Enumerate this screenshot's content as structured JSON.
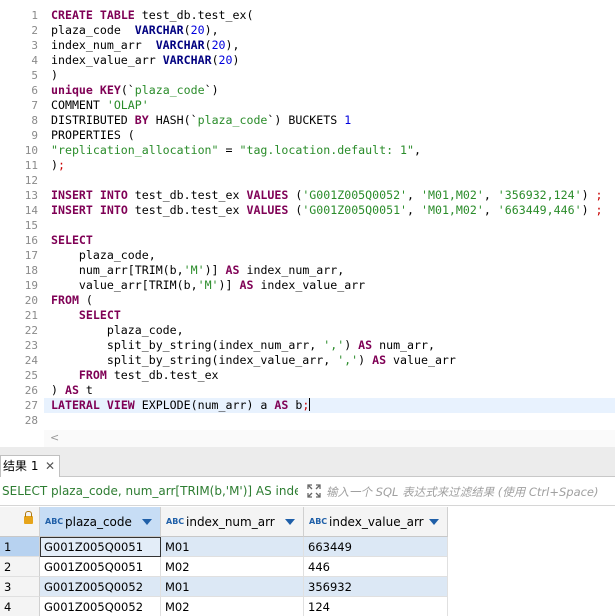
{
  "editor": {
    "lines": [
      {
        "n": "1",
        "tokens": [
          {
            "t": "kw",
            "v": "CREATE"
          },
          {
            "t": "",
            "v": " "
          },
          {
            "t": "kw",
            "v": "TABLE"
          },
          {
            "t": "",
            "v": " test_db.test_ex("
          }
        ]
      },
      {
        "n": "2",
        "tokens": [
          {
            "t": "",
            "v": "plaza_code  "
          },
          {
            "t": "kb",
            "v": "VARCHAR"
          },
          {
            "t": "",
            "v": "("
          },
          {
            "t": "num",
            "v": "20"
          },
          {
            "t": "",
            "v": "),"
          }
        ]
      },
      {
        "n": "3",
        "tokens": [
          {
            "t": "",
            "v": "index_num_arr  "
          },
          {
            "t": "kb",
            "v": "VARCHAR"
          },
          {
            "t": "",
            "v": "("
          },
          {
            "t": "num",
            "v": "20"
          },
          {
            "t": "",
            "v": "),"
          }
        ]
      },
      {
        "n": "4",
        "tokens": [
          {
            "t": "",
            "v": "index_value_arr "
          },
          {
            "t": "kb",
            "v": "VARCHAR"
          },
          {
            "t": "",
            "v": "("
          },
          {
            "t": "num",
            "v": "20"
          },
          {
            "t": "",
            "v": ")"
          }
        ]
      },
      {
        "n": "5",
        "tokens": [
          {
            "t": "",
            "v": ")"
          }
        ]
      },
      {
        "n": "6",
        "tokens": [
          {
            "t": "kw",
            "v": "unique"
          },
          {
            "t": "",
            "v": " "
          },
          {
            "t": "kw",
            "v": "KEY"
          },
          {
            "t": "",
            "v": "(`"
          },
          {
            "t": "str",
            "v": "plaza_code"
          },
          {
            "t": "",
            "v": "`)"
          }
        ]
      },
      {
        "n": "7",
        "tokens": [
          {
            "t": "",
            "v": "COMMENT "
          },
          {
            "t": "str",
            "v": "'OLAP'"
          }
        ]
      },
      {
        "n": "8",
        "tokens": [
          {
            "t": "",
            "v": "DISTRIBUTED "
          },
          {
            "t": "kw",
            "v": "BY"
          },
          {
            "t": "",
            "v": " HASH(`"
          },
          {
            "t": "str",
            "v": "plaza_code"
          },
          {
            "t": "",
            "v": "`) BUCKETS "
          },
          {
            "t": "num",
            "v": "1"
          }
        ]
      },
      {
        "n": "9",
        "tokens": [
          {
            "t": "",
            "v": "PROPERTIES ("
          }
        ]
      },
      {
        "n": "10",
        "tokens": [
          {
            "t": "str",
            "v": "\"replication_allocation\""
          },
          {
            "t": "",
            "v": " = "
          },
          {
            "t": "str",
            "v": "\"tag.location.default: 1\""
          },
          {
            "t": "",
            "v": ","
          }
        ]
      },
      {
        "n": "11",
        "tokens": [
          {
            "t": "",
            "v": ")"
          },
          {
            "t": "punc",
            "v": ";"
          }
        ]
      },
      {
        "n": "12",
        "tokens": []
      },
      {
        "n": "13",
        "tokens": [
          {
            "t": "kw",
            "v": "INSERT"
          },
          {
            "t": "",
            "v": " "
          },
          {
            "t": "kw",
            "v": "INTO"
          },
          {
            "t": "",
            "v": " test_db.test_ex "
          },
          {
            "t": "kw",
            "v": "VALUES"
          },
          {
            "t": "",
            "v": " ("
          },
          {
            "t": "str",
            "v": "'G001Z005Q0052'"
          },
          {
            "t": "",
            "v": ", "
          },
          {
            "t": "str",
            "v": "'M01,M02'"
          },
          {
            "t": "",
            "v": ", "
          },
          {
            "t": "str",
            "v": "'356932,124'"
          },
          {
            "t": "",
            "v": ") "
          },
          {
            "t": "punc",
            "v": ";"
          }
        ]
      },
      {
        "n": "14",
        "tokens": [
          {
            "t": "kw",
            "v": "INSERT"
          },
          {
            "t": "",
            "v": " "
          },
          {
            "t": "kw",
            "v": "INTO"
          },
          {
            "t": "",
            "v": " test_db.test_ex "
          },
          {
            "t": "kw",
            "v": "VALUES"
          },
          {
            "t": "",
            "v": " ("
          },
          {
            "t": "str",
            "v": "'G001Z005Q0051'"
          },
          {
            "t": "",
            "v": ", "
          },
          {
            "t": "str",
            "v": "'M01,M02'"
          },
          {
            "t": "",
            "v": ", "
          },
          {
            "t": "str",
            "v": "'663449,446'"
          },
          {
            "t": "",
            "v": ") "
          },
          {
            "t": "punc",
            "v": ";"
          }
        ]
      },
      {
        "n": "15",
        "tokens": []
      },
      {
        "n": "16",
        "tokens": [
          {
            "t": "kw",
            "v": "SELECT"
          }
        ]
      },
      {
        "n": "17",
        "tokens": [
          {
            "t": "",
            "v": "    plaza_code,"
          }
        ]
      },
      {
        "n": "18",
        "tokens": [
          {
            "t": "",
            "v": "    num_arr[TRIM(b,"
          },
          {
            "t": "str",
            "v": "'M'"
          },
          {
            "t": "",
            "v": ")] "
          },
          {
            "t": "kw",
            "v": "AS"
          },
          {
            "t": "",
            "v": " index_num_arr,"
          }
        ]
      },
      {
        "n": "19",
        "tokens": [
          {
            "t": "",
            "v": "    value_arr[TRIM(b,"
          },
          {
            "t": "str",
            "v": "'M'"
          },
          {
            "t": "",
            "v": ")] "
          },
          {
            "t": "kw",
            "v": "AS"
          },
          {
            "t": "",
            "v": " index_value_arr"
          }
        ]
      },
      {
        "n": "20",
        "tokens": [
          {
            "t": "kw",
            "v": "FROM"
          },
          {
            "t": "",
            "v": " ("
          }
        ]
      },
      {
        "n": "21",
        "tokens": [
          {
            "t": "",
            "v": "    "
          },
          {
            "t": "kw",
            "v": "SELECT"
          }
        ]
      },
      {
        "n": "22",
        "tokens": [
          {
            "t": "",
            "v": "        plaza_code,"
          }
        ]
      },
      {
        "n": "23",
        "tokens": [
          {
            "t": "",
            "v": "        split_by_string(index_num_arr, "
          },
          {
            "t": "str",
            "v": "','"
          },
          {
            "t": "",
            "v": ") "
          },
          {
            "t": "kw",
            "v": "AS"
          },
          {
            "t": "",
            "v": " num_arr,"
          }
        ]
      },
      {
        "n": "24",
        "tokens": [
          {
            "t": "",
            "v": "        split_by_string(index_value_arr, "
          },
          {
            "t": "str",
            "v": "','"
          },
          {
            "t": "",
            "v": ") "
          },
          {
            "t": "kw",
            "v": "AS"
          },
          {
            "t": "",
            "v": " value_arr"
          }
        ]
      },
      {
        "n": "25",
        "tokens": [
          {
            "t": "",
            "v": "    "
          },
          {
            "t": "kw",
            "v": "FROM"
          },
          {
            "t": "",
            "v": " test_db.test_ex"
          }
        ]
      },
      {
        "n": "26",
        "tokens": [
          {
            "t": "",
            "v": ") "
          },
          {
            "t": "kw",
            "v": "AS"
          },
          {
            "t": "",
            "v": " t"
          }
        ]
      },
      {
        "n": "27",
        "tokens": [
          {
            "t": "kw",
            "v": "LATERAL"
          },
          {
            "t": "",
            "v": " "
          },
          {
            "t": "kw",
            "v": "VIEW"
          },
          {
            "t": "",
            "v": " EXPLODE(num_arr) a "
          },
          {
            "t": "kw",
            "v": "AS"
          },
          {
            "t": "",
            "v": " b"
          },
          {
            "t": "punc",
            "v": ";"
          }
        ],
        "active": true
      },
      {
        "n": "28",
        "tokens": []
      }
    ],
    "scroll_left_icon": "chevron-left-icon"
  },
  "results": {
    "tab_label": "结果 1",
    "tab_close_glyph": "✕",
    "query_text": "SELECT plaza_code, num_arr[TRIM(b,'M')] AS index",
    "filter_placeholder": "输入一个 SQL 表达式来过滤结果 (使用 Ctrl+Space)",
    "expand_icon": "expand-icon",
    "columns": [
      {
        "type_badge": "ABC",
        "label": "plaza_code",
        "selected": true
      },
      {
        "type_badge": "ABC",
        "label": "index_num_arr",
        "selected": false
      },
      {
        "type_badge": "ABC",
        "label": "index_value_arr",
        "selected": false
      }
    ],
    "rows": [
      {
        "num": "1",
        "cells": [
          "G001Z005Q0051",
          "M01",
          "663449"
        ]
      },
      {
        "num": "2",
        "cells": [
          "G001Z005Q0051",
          "M02",
          "446"
        ]
      },
      {
        "num": "3",
        "cells": [
          "G001Z005Q0052",
          "M01",
          "356932"
        ]
      },
      {
        "num": "4",
        "cells": [
          "G001Z005Q0052",
          "M02",
          "124"
        ]
      }
    ]
  }
}
